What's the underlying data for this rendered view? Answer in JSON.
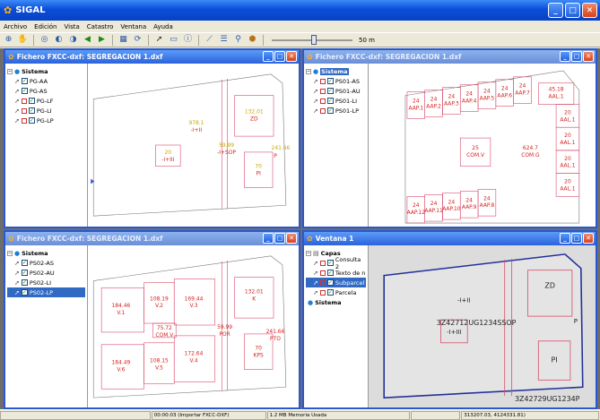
{
  "app": {
    "title": "SIGAL"
  },
  "menu": [
    "Archivo",
    "Edición",
    "Vista",
    "Catastro",
    "Ventana",
    "Ayuda"
  ],
  "toolbar": {
    "scale_label": "50 m"
  },
  "windows": [
    {
      "title": "Fichero FXCC-dxf: SEGREGACION 1.dxf",
      "tree_root": "Sistema",
      "layers": [
        "PG-AA",
        "PG-AS",
        "PG-LF",
        "PG-LI",
        "PG-LP"
      ],
      "labels": [
        "978.1",
        "-I+II",
        "132.01",
        "ZD",
        "20",
        "-I+III",
        "59.99",
        "-I+SOP",
        "241.66",
        "P",
        "70",
        "PI"
      ]
    },
    {
      "title": "Fichero FXCC-dxf: SEGREGACION 1.dxf",
      "tree_root": "Sistema",
      "layers": [
        "PS01-AS",
        "PS01-AU",
        "PS01-LI",
        "PS01-LP"
      ],
      "labels": [
        "24",
        "AAP.1",
        "24",
        "AAP.2",
        "24",
        "AAP.3",
        "24",
        "AAP.4",
        "24",
        "AAP.5",
        "24",
        "AAP.6",
        "24",
        "AAP.7",
        "45.18",
        "AAL.1",
        "20",
        "AAL.1",
        "20",
        "AAL.1",
        "20",
        "AAL.1",
        "20",
        "AAL.1",
        "25",
        "COM.V",
        "624.7",
        "COM.G",
        "24",
        "AAP.12",
        "24",
        "AAP.11",
        "24",
        "AAP.10",
        "24",
        "AAP.9",
        "24",
        "AAP.8"
      ]
    },
    {
      "title": "Fichero FXCC-dxf: SEGREGACION 1.dxf",
      "tree_root": "Sistema",
      "layers": [
        "PS02-AS",
        "PS02-AU",
        "PS02-LI",
        "PS02-LP"
      ],
      "labels": [
        "184.46",
        "V.1",
        "108.19",
        "V.2",
        "169.44",
        "V.3",
        "132.01",
        "K",
        "75.72",
        "COM.V",
        "59.99",
        "POR",
        "241.66",
        "PTO",
        "184.49",
        "V.6",
        "108.15",
        "V.5",
        "172.64",
        "V.4",
        "70",
        "KPS"
      ]
    },
    {
      "title": "Ventana 1",
      "tree_root": "Capas",
      "layers": [
        "Consulta 2",
        "Texto de n",
        "Subparcel",
        "Parcela"
      ],
      "tree_root2": "Sistema",
      "labels": [
        "-I+II",
        "ZD",
        "3Z42712UG1234SSOP",
        "-I+III",
        "P",
        "PI",
        "3Z42729UG1234P"
      ]
    }
  ],
  "status": [
    "00:00:03 (Importar FXCC-DXF)",
    "1.2 MB Memoria Usada",
    "313207.03, 4124331.81)"
  ]
}
